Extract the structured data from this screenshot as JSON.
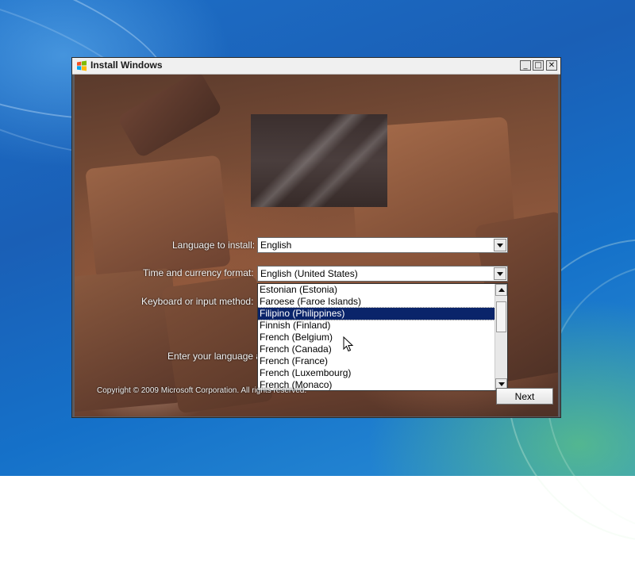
{
  "window": {
    "title": "Install Windows",
    "controls": {
      "minimize": "_",
      "maximize": "□",
      "close": "✕"
    }
  },
  "form": {
    "language_label": "Language to install:",
    "language_value": "English",
    "time_label": "Time and currency format:",
    "time_value": "English (United States)",
    "keyboard_label": "Keyboard or input method:",
    "instruction_text": "Enter your language a"
  },
  "dropdown": {
    "items": [
      "Estonian (Estonia)",
      "Faroese (Faroe Islands)",
      "Filipino (Philippines)",
      "Finnish (Finland)",
      "French (Belgium)",
      "French (Canada)",
      "French (France)",
      "French (Luxembourg)",
      "French (Monaco)"
    ],
    "selected_index": 2,
    "scroll_position_fraction": 0.1
  },
  "footer": {
    "copyright": "Copyright © 2009 Microsoft Corporation. All rights reserved.",
    "next_label": "Next"
  },
  "colors": {
    "desktop_blue": "#1a5fb6",
    "selection_navy": "#0a246a",
    "window_frame": "#f0f0f0"
  },
  "icons": [
    "windows-flag-icon",
    "minimize-icon",
    "maximize-icon",
    "close-icon",
    "dropdown-arrow-icon",
    "scroll-up-icon",
    "scroll-down-icon",
    "mouse-pointer-icon"
  ]
}
